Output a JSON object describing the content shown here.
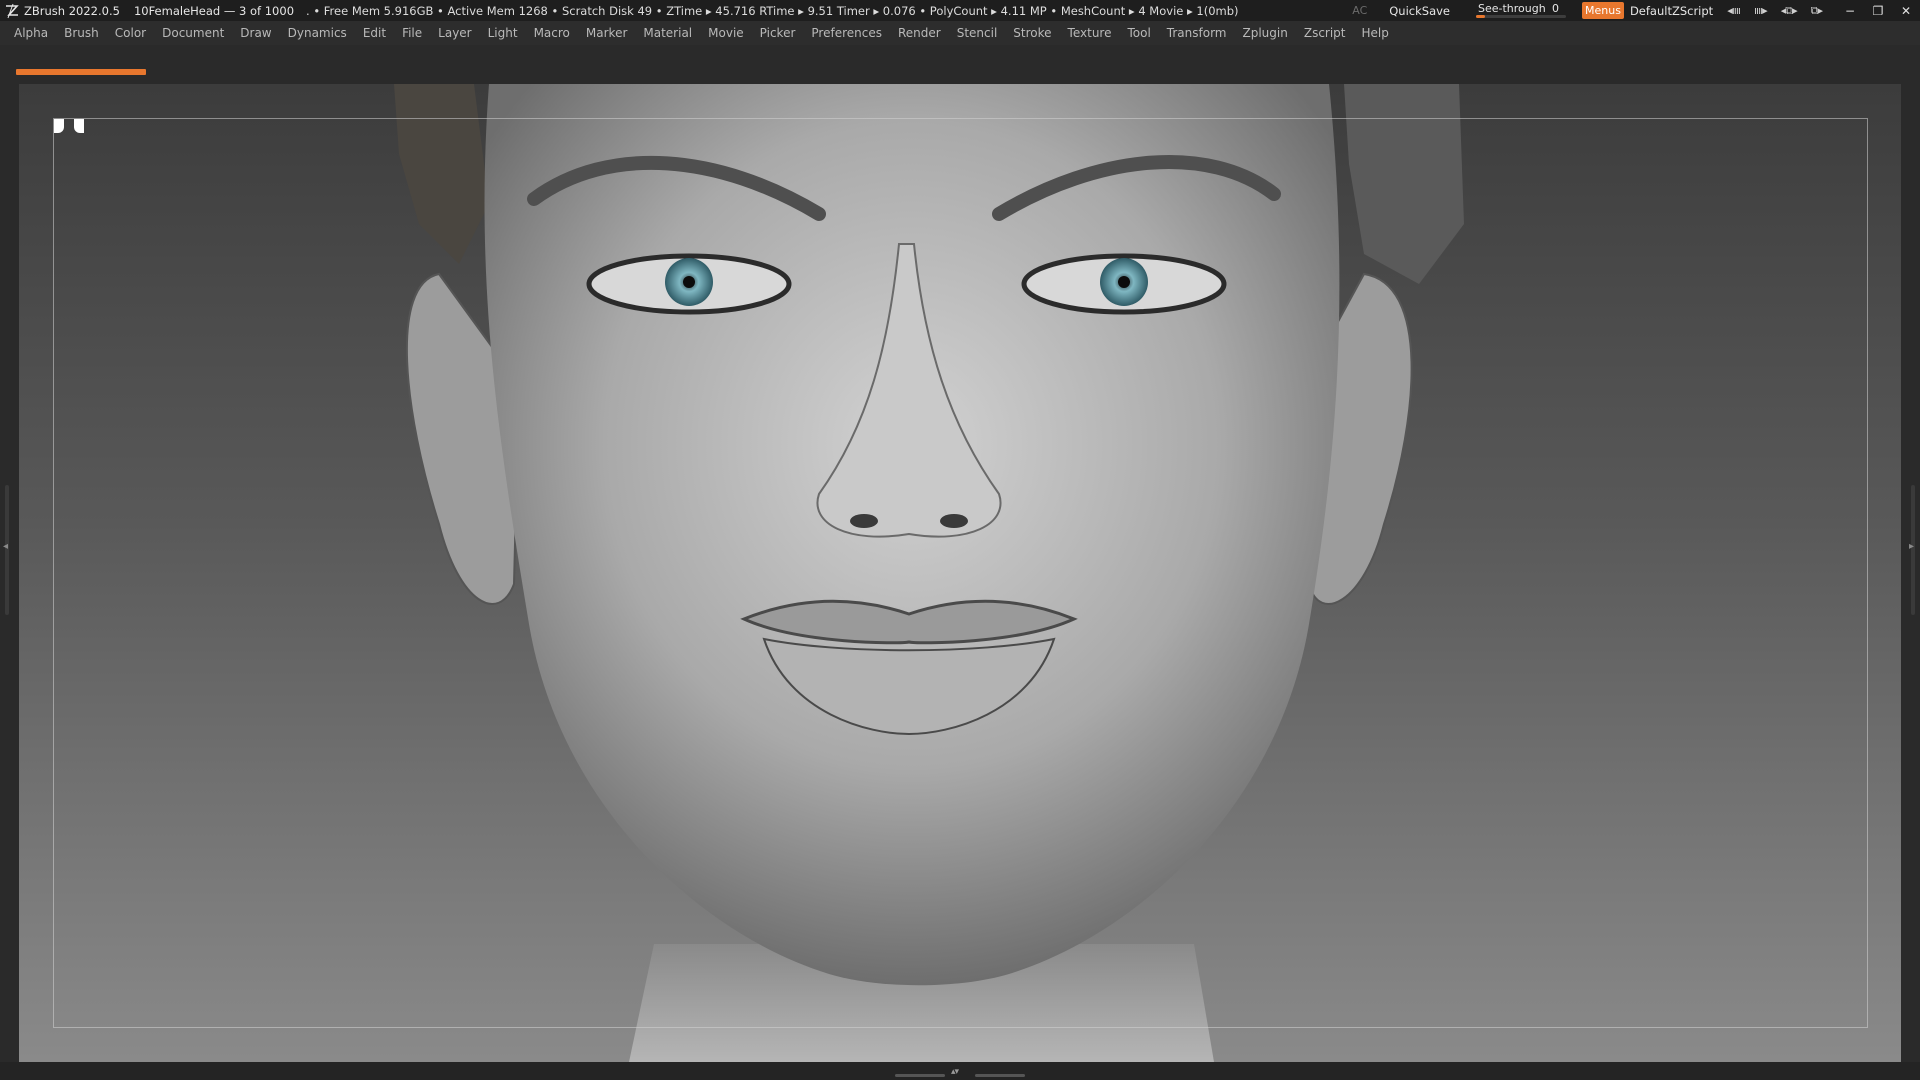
{
  "titlebar": {
    "app_name": "ZBrush 2022.0.5",
    "document": "10FemaleHead — 3 of 1000",
    "stats": ". • Free Mem 5.916GB • Active Mem 1268 • Scratch Disk 49 • ZTime ▸ 45.716 RTime ▸ 9.51 Timer ▸ 0.076 • PolyCount ▸ 4.11 MP • MeshCount ▸ 4 Movie ▸ 1(0mb)",
    "ac_label": "AC",
    "quicksave_label": "QuickSave",
    "seethrough_label": "See-through",
    "seethrough_value": "0",
    "seethrough_level": 0.1,
    "menus_label": "Menus",
    "script_label": "DefaultZScript",
    "icon_1": "◂ıııı",
    "icon_2": "ıııı▸",
    "icon_3": "◂⧉▸",
    "icon_4": "⧉▸",
    "minimize": "−",
    "restore": "❐",
    "close": "✕"
  },
  "menubar": {
    "items": [
      "Alpha",
      "Brush",
      "Color",
      "Document",
      "Draw",
      "Dynamics",
      "Edit",
      "File",
      "Layer",
      "Light",
      "Macro",
      "Marker",
      "Material",
      "Movie",
      "Picker",
      "Preferences",
      "Render",
      "Stencil",
      "Stroke",
      "Texture",
      "Tool",
      "Transform",
      "Zplugin",
      "Zscript",
      "Help"
    ]
  },
  "colors": {
    "accent": "#e8772e",
    "titlebar_bg": "#1e1e1e",
    "menubar_bg": "#2d2d2d",
    "menu_text": "#b9b9b9"
  },
  "icons": {
    "app_logo": "zbrush-logo-icon",
    "side_arrow_left": "◂",
    "side_arrow_right": "▸",
    "bottom_arrows": "▴▾"
  }
}
